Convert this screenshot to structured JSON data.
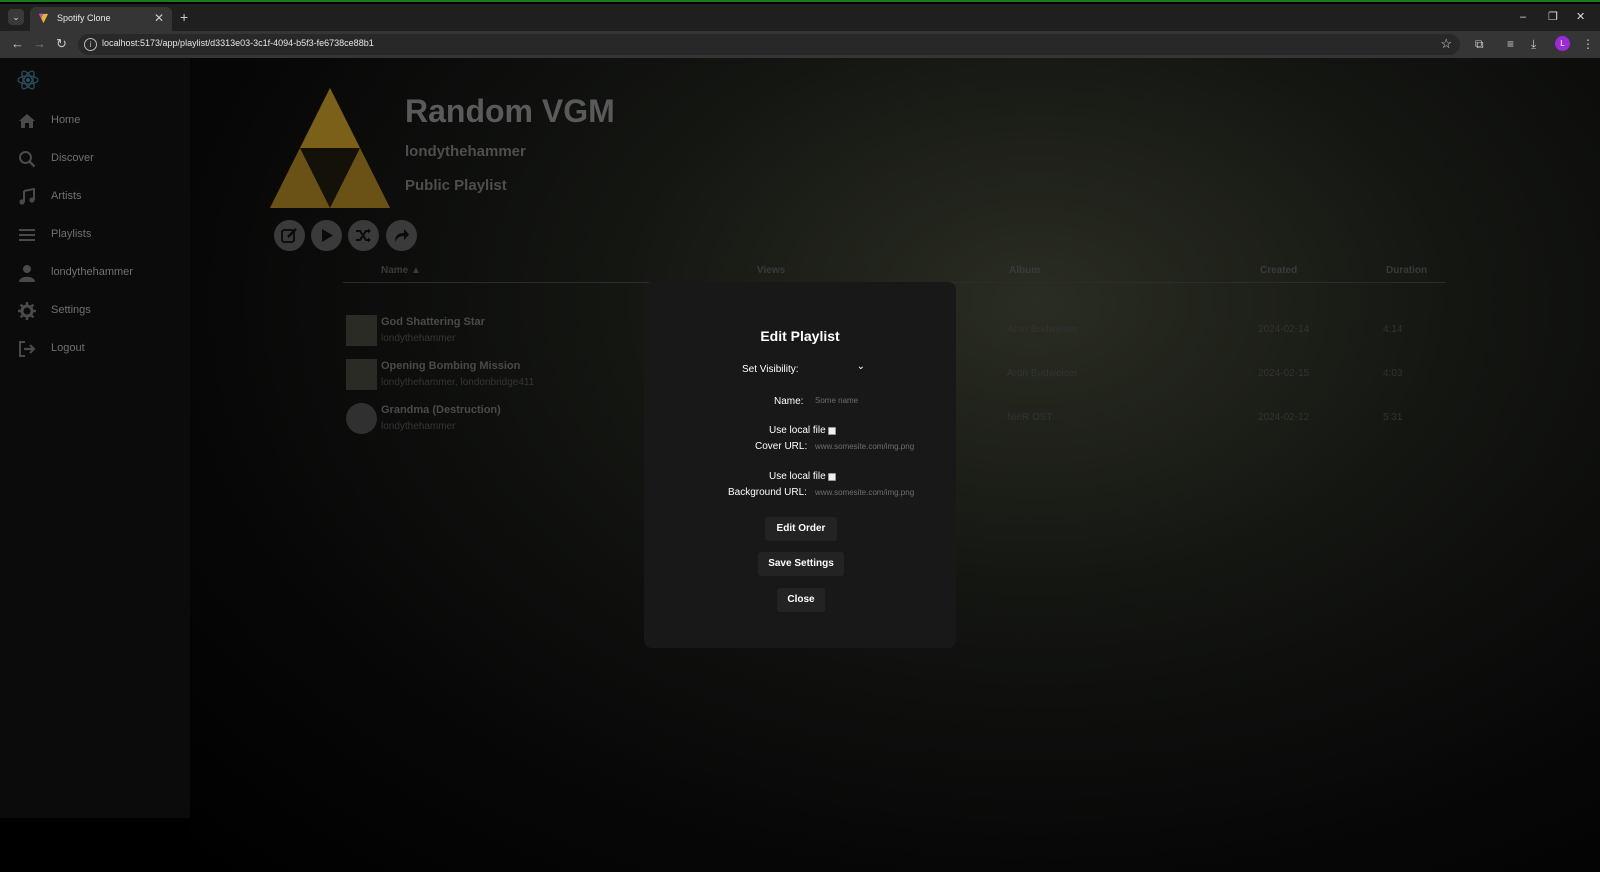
{
  "browser": {
    "tab_title": "Spotify Clone",
    "new_tab": "+",
    "url": "localhost:5173/app/playlist/d3313e03-3c1f-4094-b5f3-fe6738ce88b1",
    "window_controls": {
      "minimize": "–",
      "restore": "❐",
      "close": "✕"
    },
    "tab_close": "✕",
    "profile_initial": "L"
  },
  "sidebar": {
    "items": [
      {
        "label": "Home",
        "icon": "home-icon"
      },
      {
        "label": "Discover",
        "icon": "search-icon"
      },
      {
        "label": "Artists",
        "icon": "music-note-icon"
      },
      {
        "label": "Playlists",
        "icon": "list-icon"
      },
      {
        "label": "londythehammer",
        "icon": "user-icon"
      },
      {
        "label": "Settings",
        "icon": "gear-icon"
      },
      {
        "label": "Logout",
        "icon": "logout-icon"
      }
    ]
  },
  "playlist": {
    "title": "Random VGM",
    "owner": "londythehammer",
    "visibility": "Public Playlist"
  },
  "table": {
    "headers": {
      "name": "Name ▲",
      "views": "Views",
      "album": "Album",
      "created": "Created",
      "duration": "Duration"
    },
    "rows": [
      {
        "title": "God Shattering Star",
        "artist": "londythehammer",
        "album": "Aron Budweiser",
        "created": "2024-02-14",
        "duration": "4:14"
      },
      {
        "title": "Opening Bombing Mission",
        "artist": "londythehammer, londonbridge411",
        "album": "Aron Budweiser",
        "created": "2024-02-15",
        "duration": "4:03"
      },
      {
        "title": "Grandma (Destruction)",
        "artist": "londythehammer",
        "album": "NieR OST",
        "created": "2024-02-12",
        "duration": "5:31"
      }
    ]
  },
  "modal": {
    "title": "Edit Playlist",
    "visibility_label": "Set Visibility:",
    "visibility_caret": "⌄",
    "name_label": "Name:",
    "name_placeholder": "Some name",
    "use_local_file_label": "Use local file",
    "cover_url_label": "Cover URL:",
    "cover_url_placeholder": "www.somesite.com/img.png",
    "background_url_label": "Background URL:",
    "background_url_placeholder": "www.somesite.com/img.png",
    "edit_order_button": "Edit Order",
    "save_settings_button": "Save Settings",
    "close_button": "Close"
  },
  "colors": {
    "modal_bg": "#181818",
    "button_bg": "#232323",
    "browser_accent": "#1a7a1a",
    "profile": "#9a2bd6",
    "cover_gold": "#8a6a14"
  }
}
